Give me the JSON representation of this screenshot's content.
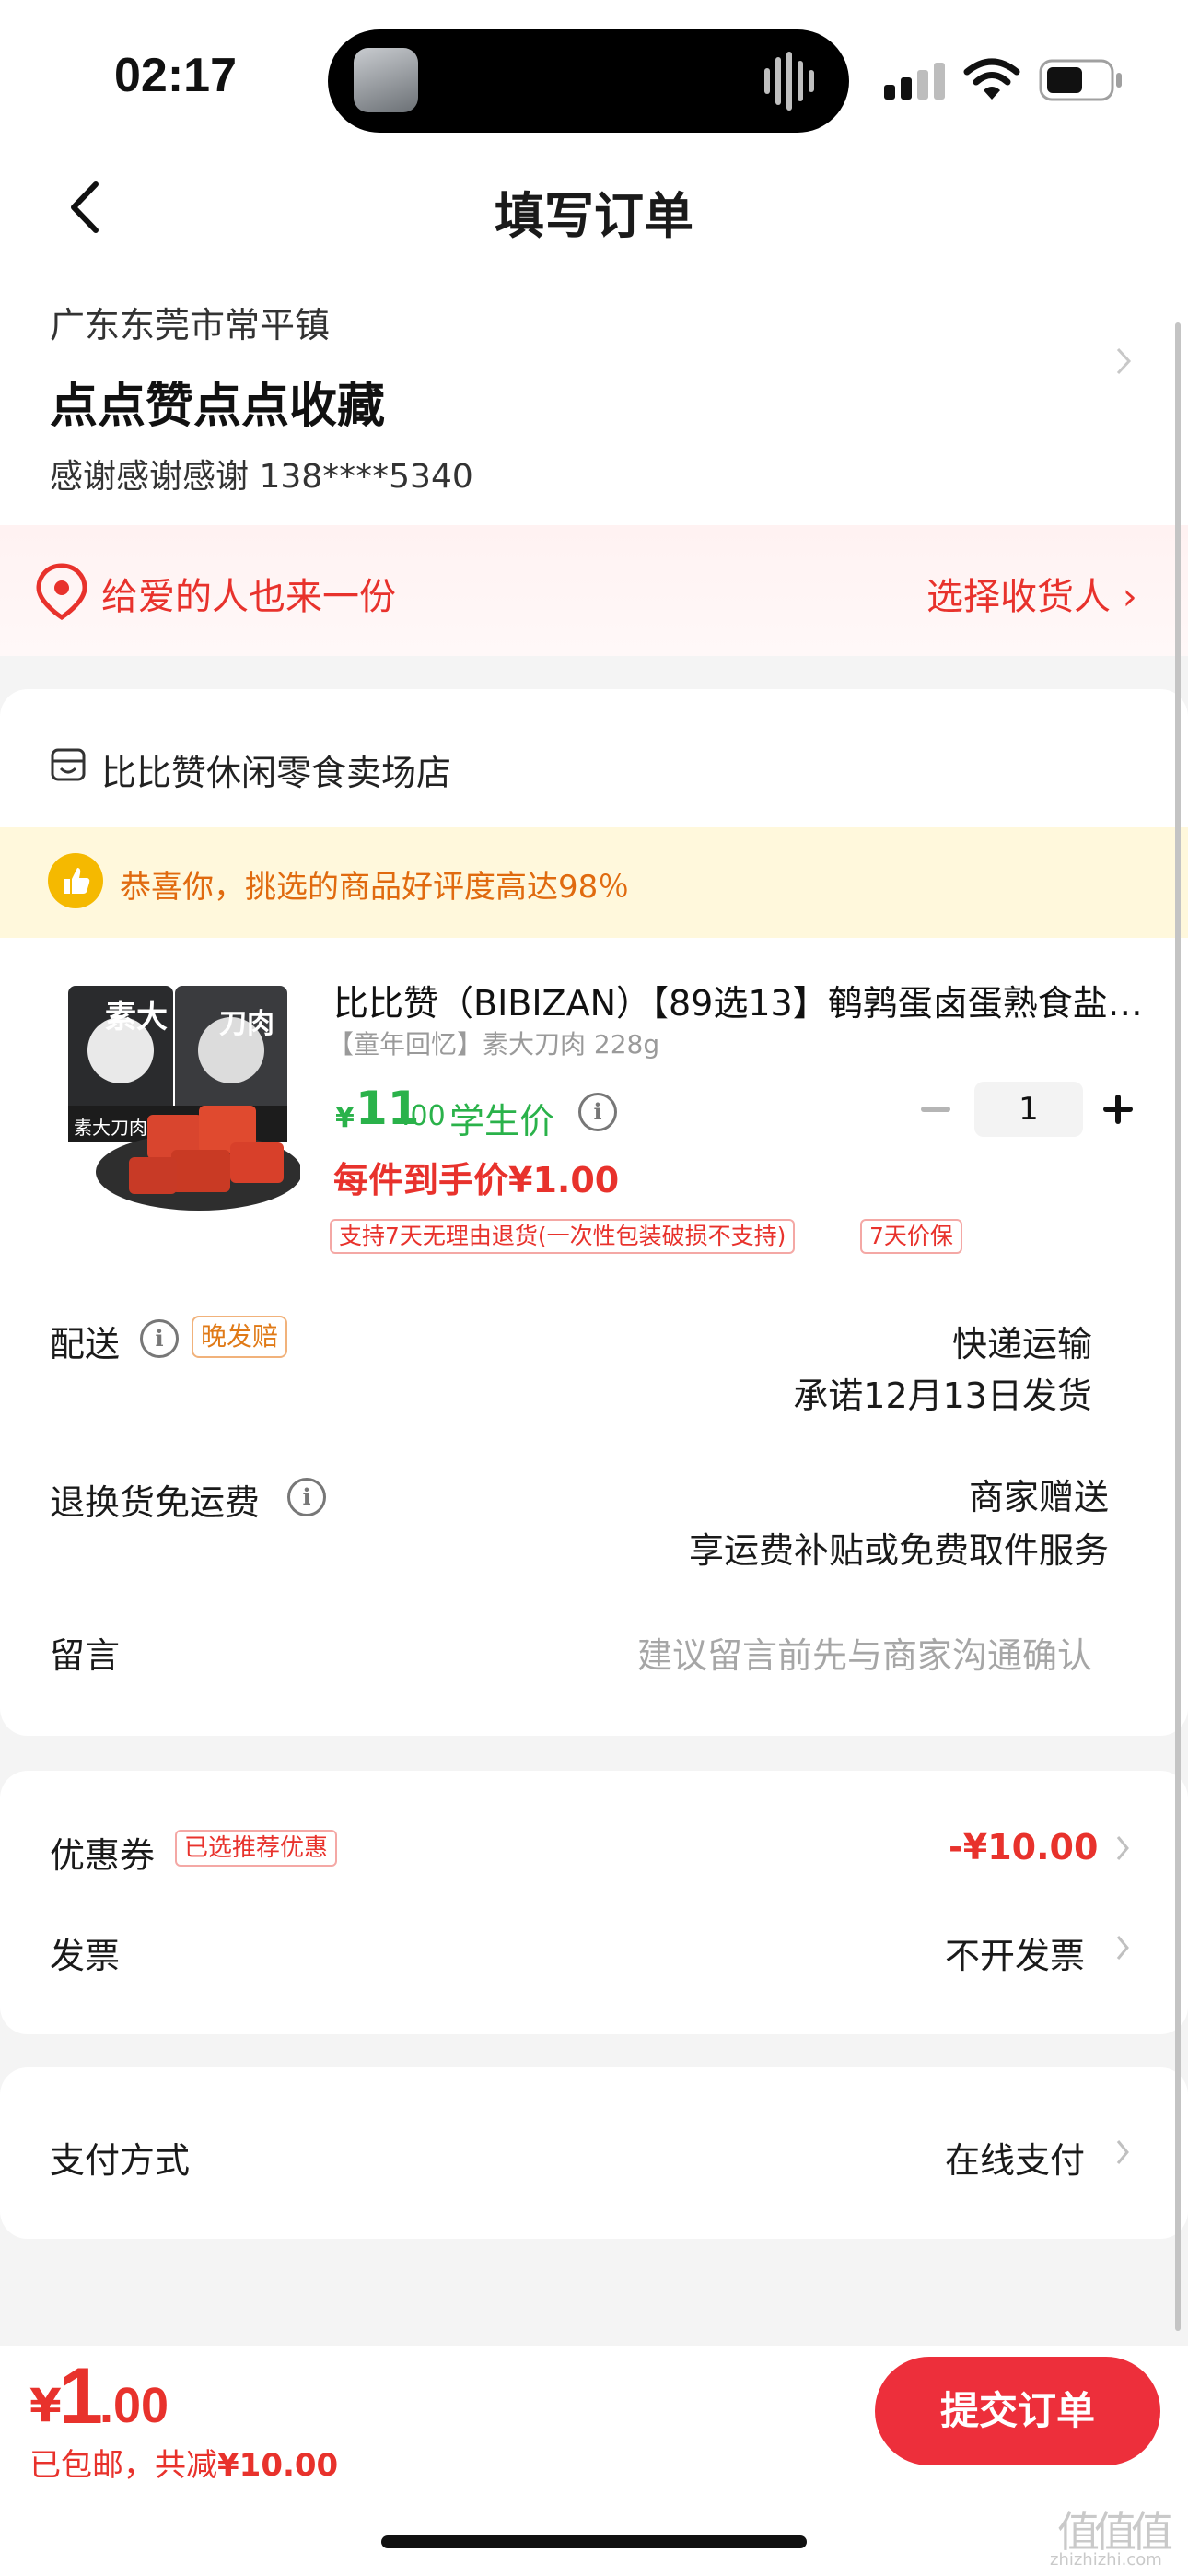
{
  "status_bar": {
    "time": "02:17"
  },
  "header": {
    "title": "填写订单"
  },
  "address": {
    "region": "广东东莞市常平镇",
    "detail": "点点赞点点收藏",
    "contact": "感谢感谢感谢  138****5340"
  },
  "gift": {
    "text": "给爱的人也来一份",
    "action": "选择收货人 ›"
  },
  "shop": {
    "name": "比比赞休闲零食卖场店",
    "praise": "恭喜你，挑选的商品好评度高达98％"
  },
  "product": {
    "title": "比比赞（BIBIZAN）【89选13】鹌鹑蛋卤蛋熟食盐…",
    "spec": "【童年回忆】素大刀肉 228g",
    "price_symbol": "¥",
    "price_int": "11",
    "price_dec": ".00",
    "price_tag": "学生价",
    "quantity": "1",
    "unit_price": "每件到手价¥1.00",
    "tags": [
      "支持7天无理由退货(一次性包装破损不支持)",
      "7天价保"
    ],
    "image_text": [
      "素大",
      "刀肉",
      "素大刀肉"
    ]
  },
  "delivery": {
    "label": "配送",
    "tag": "晚发赔",
    "method": "快递运输",
    "promise": "承诺12月13日发货"
  },
  "return_shipping": {
    "label": "退换货免运费",
    "value1": "商家赠送",
    "value2": "享运费补贴或免费取件服务"
  },
  "message": {
    "label": "留言",
    "placeholder": "建议留言前先与商家沟通确认"
  },
  "coupon": {
    "label": "优惠券",
    "tag": "已选推荐优惠",
    "value": "-¥10.00"
  },
  "invoice": {
    "label": "发票",
    "value": "不开发票"
  },
  "payment": {
    "label": "支付方式",
    "value": "在线支付"
  },
  "bottom": {
    "total_symbol": "¥",
    "total_int": "1",
    "total_dec": ".00",
    "shipping_prefix": "已包邮，共减",
    "discount": "¥10.00",
    "submit": "提交订单"
  },
  "watermark": {
    "main": "值值值",
    "sub": "zhizhizhi.com"
  },
  "colors": {
    "accent_red": "#e8322c",
    "price_green": "#2ab24a",
    "submit_red": "#ed2f3b",
    "praise_orange": "#e06a0f"
  }
}
